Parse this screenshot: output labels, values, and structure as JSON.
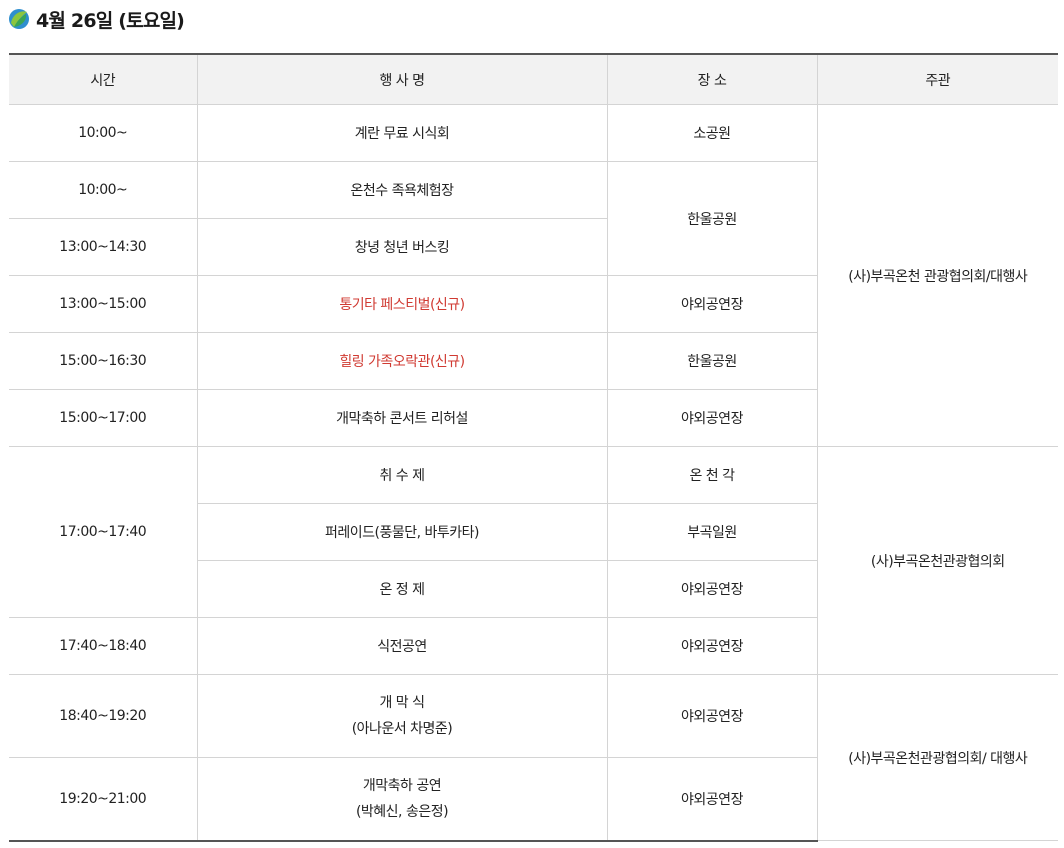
{
  "page": {
    "title": "4월 26일 (토요일)"
  },
  "headers": {
    "time": "시간",
    "event": "행 사 명",
    "place": "장 소",
    "host": "주관"
  },
  "rows": [
    {
      "time": "10:00~",
      "event": "계란 무료 시식회",
      "place": "소공원",
      "host": "(사)부곡온천 관광협의회/대행사"
    },
    {
      "time": "10:00~",
      "event": "온천수 족욕체험장",
      "place": "한울공원"
    },
    {
      "time": "13:00~14:30",
      "event": "창녕 청년 버스킹"
    },
    {
      "time": "13:00~15:00",
      "event": "통기타 페스티벌(신규)",
      "place": "야외공연장"
    },
    {
      "time": "15:00~16:30",
      "event": "힐링 가족오락관(신규)",
      "place": "한울공원"
    },
    {
      "time": "15:00~17:00",
      "event": "개막축하 콘서트 리허설",
      "place": "야외공연장"
    },
    {
      "time": "17:00~17:40",
      "event": "취 수 제",
      "place": "온 천 각",
      "host": "(사)부곡온천관광협의회"
    },
    {
      "event": "퍼레이드(풍물단, 바투카타)",
      "place": "부곡일원"
    },
    {
      "event": "온 정 제",
      "place": "야외공연장"
    },
    {
      "time": "17:40~18:40",
      "event": "식전공연",
      "place": "야외공연장"
    },
    {
      "time": "18:40~19:20",
      "event_line1": "개 막 식",
      "event_line2": "(아나운서 차명준)",
      "place": "야외공연장",
      "host": "(사)부곡온천관광협의회/ 대행사"
    },
    {
      "time": "19:20~21:00",
      "event_line1": "개막축하 공연",
      "event_line2": "(박혜신, 송은정)",
      "place": "야외공연장"
    }
  ],
  "colors": {
    "highlight": "#d03a32",
    "header_bg": "#f2f2f2",
    "border": "#d4d4d4"
  },
  "icons": {
    "title_icon": "leaf-logo-icon"
  }
}
